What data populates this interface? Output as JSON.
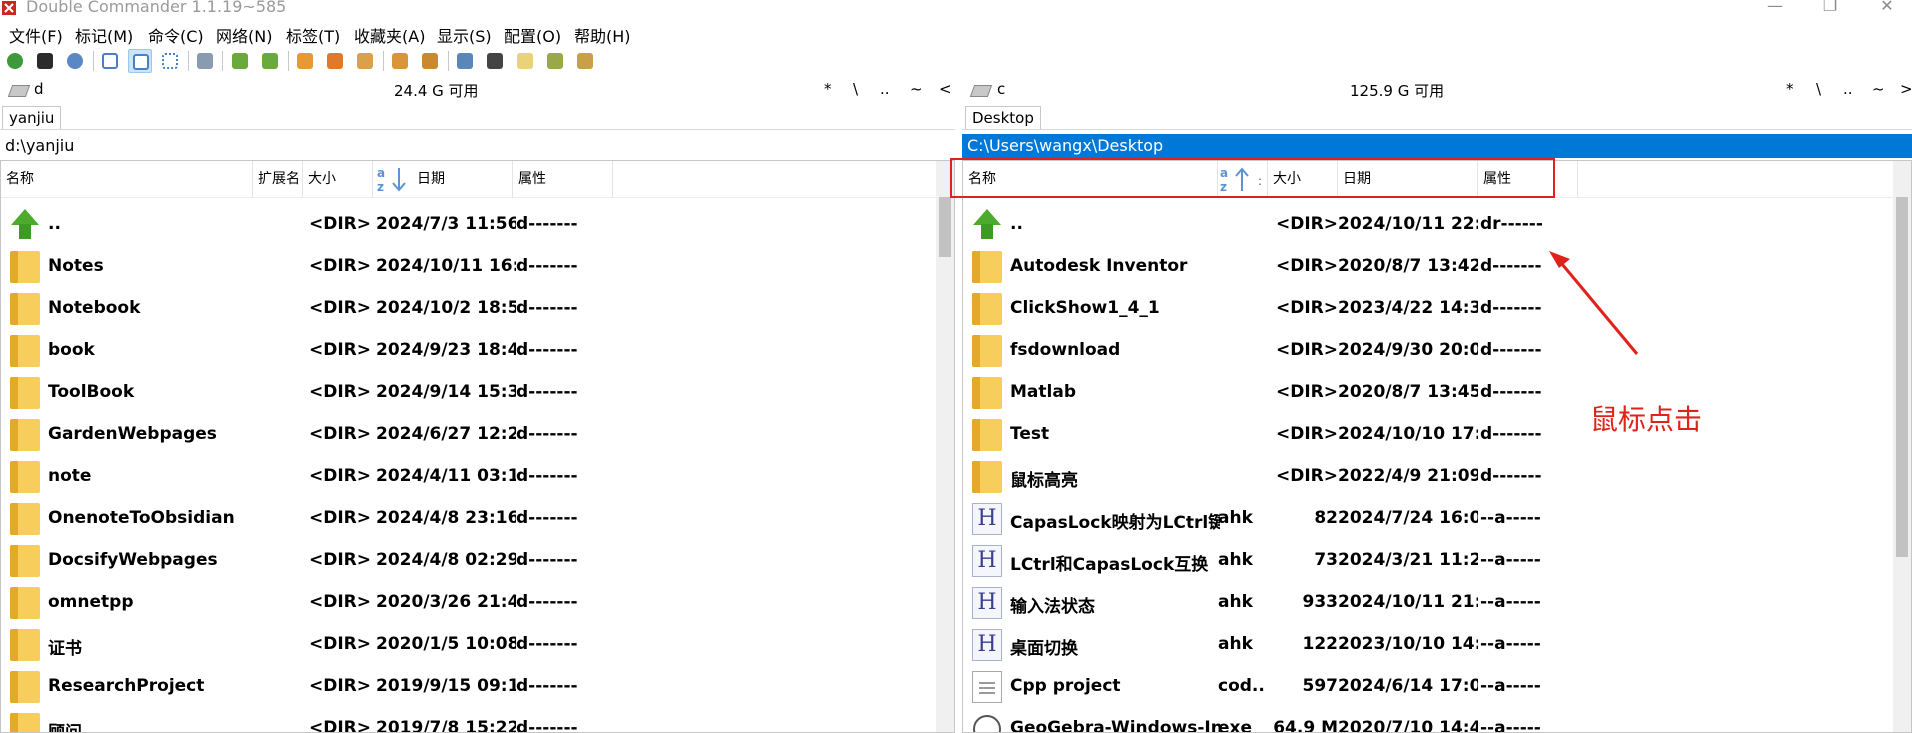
{
  "window": {
    "title": "Double Commander 1.1.19~585",
    "controls": [
      "—",
      "❐",
      "✕"
    ]
  },
  "menu": [
    "文件(F)",
    "标记(M)",
    "命令(C)",
    "网络(N)",
    "标签(T)",
    "收藏夹(A)",
    "显示(S)",
    "配置(O)",
    "帮助(H)"
  ],
  "toolbar_icons": [
    "refresh-icon",
    "terminal-icon",
    "settings-icon",
    "brief-view-icon",
    "full-view-icon",
    "thumbnail-view-icon",
    "compare-icon",
    "copy-left-icon",
    "copy-right-icon",
    "rename-icon",
    "search-icon",
    "sync-icon",
    "pack-icon",
    "unpack-icon",
    "multi-rename-icon",
    "binoculars-icon",
    "edit-icon",
    "copy-icon",
    "paste-icon"
  ],
  "colors": {
    "accent": "#0078d7",
    "annotation": "#e0231a",
    "folder": "#f7cd5b"
  },
  "left": {
    "drive": "d",
    "free": "24.4 G 可用",
    "nav": [
      "*",
      "\\",
      "..",
      "~",
      "<"
    ],
    "tab": "yanjiu",
    "path": "d:\\yanjiu",
    "headers": {
      "name": "名称",
      "ext": "扩展名",
      "size": "大小",
      "date": "日期",
      "attr": "属性"
    },
    "rows": [
      {
        "icon": "up",
        "name": "..",
        "ext": "",
        "size": "<DIR>",
        "date": "2024/7/3 11:56..",
        "attr": "d-------"
      },
      {
        "icon": "folder",
        "name": "Notes",
        "ext": "",
        "size": "<DIR>",
        "date": "2024/10/11 16:..",
        "attr": "d-------"
      },
      {
        "icon": "folder",
        "name": "Notebook",
        "ext": "",
        "size": "<DIR>",
        "date": "2024/10/2 18:5..",
        "attr": "d-------"
      },
      {
        "icon": "folder",
        "name": "book",
        "ext": "",
        "size": "<DIR>",
        "date": "2024/9/23 18:4..",
        "attr": "d-------"
      },
      {
        "icon": "folder",
        "name": "ToolBook",
        "ext": "",
        "size": "<DIR>",
        "date": "2024/9/14 15:3..",
        "attr": "d-------"
      },
      {
        "icon": "folder",
        "name": "GardenWebpages",
        "ext": "",
        "size": "<DIR>",
        "date": "2024/6/27 12:2..",
        "attr": "d-------"
      },
      {
        "icon": "folder",
        "name": "note",
        "ext": "",
        "size": "<DIR>",
        "date": "2024/4/11 03:1..",
        "attr": "d-------"
      },
      {
        "icon": "folder",
        "name": "OnenoteToObsidian",
        "ext": "",
        "size": "<DIR>",
        "date": "2024/4/8 23:16..",
        "attr": "d-------"
      },
      {
        "icon": "folder",
        "name": "DocsifyWebpages",
        "ext": "",
        "size": "<DIR>",
        "date": "2024/4/8 02:29..",
        "attr": "d-------"
      },
      {
        "icon": "folder",
        "name": "omnetpp",
        "ext": "",
        "size": "<DIR>",
        "date": "2020/3/26 21:4..",
        "attr": "d-------"
      },
      {
        "icon": "folder",
        "name": "证书",
        "ext": "",
        "size": "<DIR>",
        "date": "2020/1/5 10:08..",
        "attr": "d-------"
      },
      {
        "icon": "folder",
        "name": "ResearchProject",
        "ext": "",
        "size": "<DIR>",
        "date": "2019/9/15 09:1..",
        "attr": "d-------"
      },
      {
        "icon": "folder",
        "name": "顾问",
        "ext": "",
        "size": "<DIR>",
        "date": "2019/7/8 15:22..",
        "attr": "d-------"
      }
    ]
  },
  "right": {
    "drive": "c",
    "free": "125.9 G 可用",
    "nav": [
      "*",
      "\\",
      "..",
      "~",
      ">"
    ],
    "tab": "Desktop",
    "path": "C:\\Users\\wangx\\Desktop",
    "headers": {
      "name": "名称",
      "ext": "",
      "size": "大小",
      "date": "日期",
      "attr": "属性"
    },
    "rows": [
      {
        "icon": "up",
        "name": "..",
        "ext": "",
        "size": "<DIR>",
        "date": "2024/10/11 22:..",
        "attr": "dr------"
      },
      {
        "icon": "folder",
        "name": "Autodesk Inventor",
        "ext": "",
        "size": "<DIR>",
        "date": "2020/8/7 13:42..",
        "attr": "d-------"
      },
      {
        "icon": "folder",
        "name": "ClickShow1_4_1",
        "ext": "",
        "size": "<DIR>",
        "date": "2023/4/22 14:3..",
        "attr": "d-------"
      },
      {
        "icon": "folder",
        "name": "fsdownload",
        "ext": "",
        "size": "<DIR>",
        "date": "2024/9/30 20:0..",
        "attr": "d-------"
      },
      {
        "icon": "folder",
        "name": "Matlab",
        "ext": "",
        "size": "<DIR>",
        "date": "2020/8/7 13:45..",
        "attr": "d-------"
      },
      {
        "icon": "folder",
        "name": "Test",
        "ext": "",
        "size": "<DIR>",
        "date": "2024/10/10 17:..",
        "attr": "d-------"
      },
      {
        "icon": "folder",
        "name": "鼠标高亮",
        "ext": "",
        "size": "<DIR>",
        "date": "2022/4/9 21:09..",
        "attr": "d-------"
      },
      {
        "icon": "ahk",
        "name": "CapasLock映射为LCtrl键",
        "ext": "ahk",
        "size": "82",
        "date": "2024/7/24 16:0..",
        "attr": "--a-----"
      },
      {
        "icon": "ahk",
        "name": "LCtrl和CapasLock互换",
        "ext": "ahk",
        "size": "73",
        "date": "2024/3/21 11:2..",
        "attr": "--a-----"
      },
      {
        "icon": "ahk",
        "name": "输入法状态",
        "ext": "ahk",
        "size": "933",
        "date": "2024/10/11 21:..",
        "attr": "--a-----"
      },
      {
        "icon": "ahk",
        "name": "桌面切换",
        "ext": "ahk",
        "size": "122",
        "date": "2023/10/10 14:..",
        "attr": "--a-----"
      },
      {
        "icon": "file",
        "name": "Cpp project",
        "ext": "cod..",
        "size": "597",
        "date": "2024/6/14 17:0..",
        "attr": "--a-----"
      },
      {
        "icon": "geo",
        "name": "GeoGebra-Windows-In..",
        "ext": "exe",
        "size": "64.9 M",
        "date": "2020/7/10 14:4..",
        "attr": "--a-----"
      }
    ]
  },
  "annotation": {
    "label": "鼠标点击"
  }
}
